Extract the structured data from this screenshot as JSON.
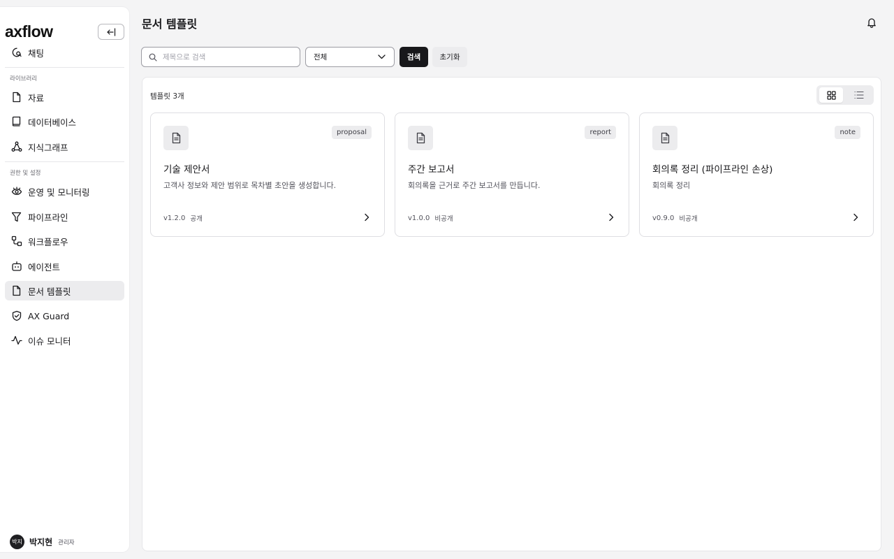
{
  "brand": {
    "logo": "axflow"
  },
  "sidebar": {
    "chat": "채팅",
    "section_library": "라이브러리",
    "library_items": [
      {
        "label": "자료",
        "icon": "file-icon"
      },
      {
        "label": "데이터베이스",
        "icon": "book-icon"
      },
      {
        "label": "지식그래프",
        "icon": "graph-icon"
      }
    ],
    "section_settings": "권한 및 설정",
    "settings_items": [
      {
        "label": "운영 및 모니터링",
        "icon": "eye-icon"
      },
      {
        "label": "파이프라인",
        "icon": "funnel-icon"
      },
      {
        "label": "워크플로우",
        "icon": "workflow-icon"
      },
      {
        "label": "에이전트",
        "icon": "bot-icon"
      },
      {
        "label": "문서 템플릿",
        "icon": "file-icon",
        "active": true
      },
      {
        "label": "AX Guard",
        "icon": "shield-icon"
      },
      {
        "label": "이슈 모니터",
        "icon": "activity-icon"
      }
    ],
    "user": {
      "avatar": "박지",
      "name": "박지현",
      "role": "관리자"
    }
  },
  "header": {
    "title": "문서 템플릿"
  },
  "filters": {
    "search_placeholder": "제목으로 검색",
    "search_value": "",
    "select_value": "전체",
    "search_button": "검색",
    "reset_button": "초기화"
  },
  "list": {
    "count_label": "템플릿 3개",
    "view_mode": "grid",
    "cards": [
      {
        "tag": "proposal",
        "title": "기술 제안서",
        "desc": "고객사 정보와 제안 범위로 목차별 초안을 생성합니다.",
        "version": "v1.2.0",
        "visibility": "공개"
      },
      {
        "tag": "report",
        "title": "주간 보고서",
        "desc": "회의록을 근거로 주간 보고서를 만듭니다.",
        "version": "v1.0.0",
        "visibility": "비공개"
      },
      {
        "tag": "note",
        "title": "회의록 정리 (파이프라인 손상)",
        "desc": "회의록 정리",
        "version": "v0.9.0",
        "visibility": "비공개"
      }
    ]
  },
  "colors": {
    "primary": "#18181b",
    "muted": "#ececee",
    "active_nav": "#ececee"
  }
}
